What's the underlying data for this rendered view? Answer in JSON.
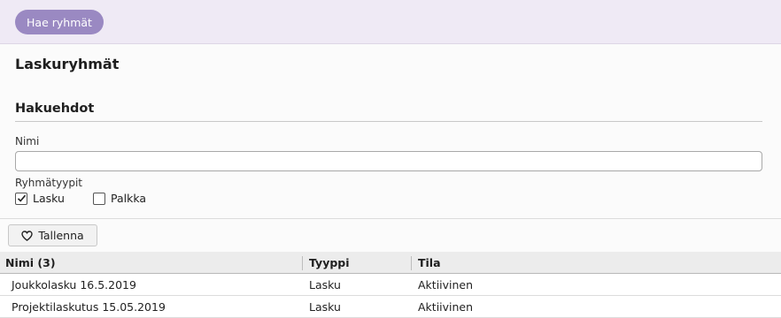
{
  "topbar": {
    "fetch_groups_label": "Hae ryhmät"
  },
  "page": {
    "title": "Laskuryhmät"
  },
  "search": {
    "section_title": "Hakuehdot",
    "name_label": "Nimi",
    "name_value": "",
    "group_types_label": "Ryhmätyypit",
    "options": [
      {
        "label": "Lasku",
        "checked": true
      },
      {
        "label": "Palkka",
        "checked": false
      }
    ]
  },
  "actions": {
    "save_label": "Tallenna"
  },
  "table": {
    "columns": [
      "Nimi (3)",
      "Tyyppi",
      "Tila"
    ],
    "rows": [
      {
        "name": "Joukkolasku 16.5.2019",
        "type": "Lasku",
        "status": "Aktiivinen"
      },
      {
        "name": "Projektilaskutus 15.05.2019",
        "type": "Lasku",
        "status": "Aktiivinen"
      }
    ]
  },
  "colors": {
    "accent": "#9a89c2",
    "topbar_bg": "#efeaf5"
  }
}
